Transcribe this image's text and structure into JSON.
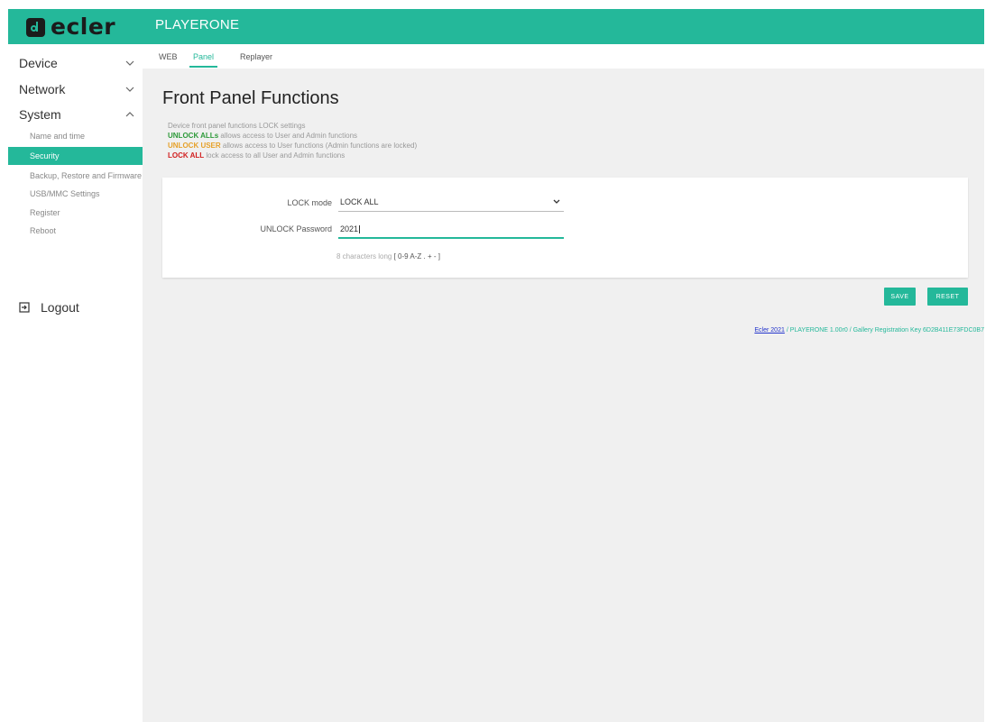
{
  "brand": {
    "logo_text": "ecler",
    "app_title": "PLAYERONE"
  },
  "colors": {
    "accent": "#24b89a",
    "unlock_all": "#2e9a3a",
    "unlock_user": "#e6a12a",
    "lock_all": "#d11f1f",
    "link": "#2233cc"
  },
  "sidebar": {
    "groups": [
      {
        "label": "Device",
        "icon": "chevron-down-icon"
      },
      {
        "label": "Network",
        "icon": "chevron-down-icon"
      },
      {
        "label": "System",
        "icon": "chevron-up-icon"
      }
    ],
    "system_items": [
      {
        "label": "Name and time"
      },
      {
        "label": "Security",
        "active": true
      },
      {
        "label": "Backup, Restore and Firmware"
      },
      {
        "label": "USB/MMC Settings"
      },
      {
        "label": "Register"
      },
      {
        "label": "Reboot"
      }
    ],
    "logout_label": "Logout",
    "logout_icon": "logout-icon"
  },
  "tabs": [
    {
      "label": "WEB"
    },
    {
      "label": "Panel",
      "active": true
    },
    {
      "label": "Replayer"
    }
  ],
  "page": {
    "title": "Front Panel Functions",
    "description": {
      "intro": "Device front panel functions LOCK settings",
      "unlock_all_key": "UNLOCK ALLs",
      "unlock_all_text": "allows access to User and Admin functions",
      "unlock_user_key": "UNLOCK USER",
      "unlock_user_text": "allows access to User functions (Admin functions are locked)",
      "lock_all_key": "LOCK ALL",
      "lock_all_text": "lock access to all User and Admin functions"
    }
  },
  "form": {
    "lock_mode_label": "LOCK mode",
    "lock_mode_value": "LOCK ALL",
    "password_label": "UNLOCK Password",
    "password_value": "2021",
    "hint_prefix": "8 characters long",
    "hint_chars": "[ 0-9 A-Z . + - ]"
  },
  "buttons": {
    "save": "SAVE",
    "reset": "RESET"
  },
  "footer": {
    "link_text": "Ecler 2021",
    "rest": "/ PLAYERONE 1.00r0 / Gallery Registration Key 6D2B411E73FDC0B7"
  }
}
